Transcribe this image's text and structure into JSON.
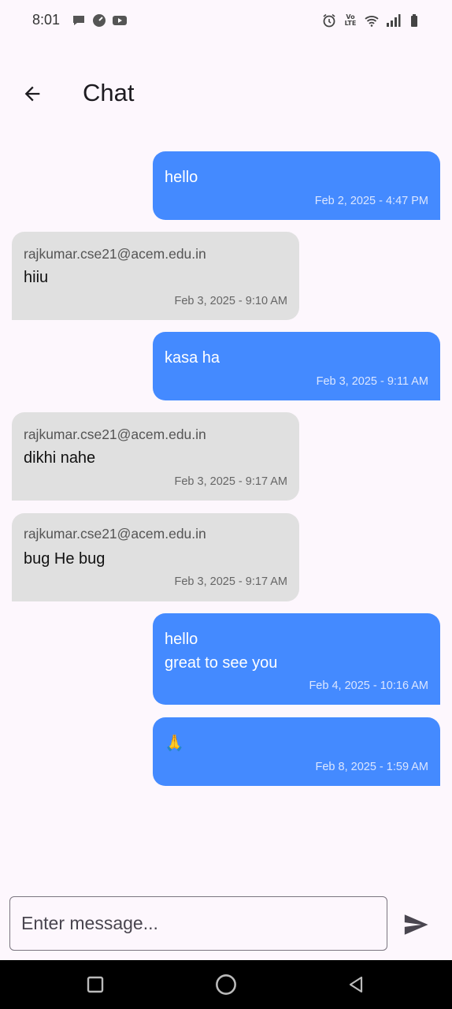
{
  "status_bar": {
    "time": "8:01",
    "left_icons": [
      "chat-notification-icon",
      "speedometer-icon",
      "youtube-icon"
    ],
    "right_icons": [
      "alarm-icon",
      "volte-icon",
      "wifi-icon",
      "signal-icon",
      "battery-icon"
    ],
    "volte_text": "Vo LTE"
  },
  "app_bar": {
    "title": "Chat",
    "back_icon": "arrow-left-icon"
  },
  "messages": [
    {
      "type": "sent",
      "text": "hello",
      "time": "Feb 2, 2025 - 4:47 PM"
    },
    {
      "type": "received",
      "sender": "rajkumar.cse21@acem.edu.in",
      "text": "hiiu",
      "time": "Feb 3, 2025 - 9:10 AM"
    },
    {
      "type": "sent",
      "text": "kasa ha",
      "time": "Feb 3, 2025 - 9:11 AM"
    },
    {
      "type": "received",
      "sender": "rajkumar.cse21@acem.edu.in",
      "text": "dikhi nahe",
      "time": "Feb 3, 2025 - 9:17 AM"
    },
    {
      "type": "received",
      "sender": "rajkumar.cse21@acem.edu.in",
      "text": "bug He bug",
      "time": "Feb 3, 2025 - 9:17 AM"
    },
    {
      "type": "sent",
      "text": "hello\ngreat to see you",
      "time": "Feb 4, 2025 - 10:16 AM"
    },
    {
      "type": "sent",
      "text": "🙏",
      "time": "Feb 8, 2025 - 1:59 AM"
    }
  ],
  "composer": {
    "placeholder": "Enter message...",
    "value": "",
    "send_icon": "send-icon"
  },
  "nav_bar": {
    "buttons": [
      "recents-square-icon",
      "home-circle-icon",
      "back-triangle-icon"
    ]
  },
  "colors": {
    "background": "#fdf7fd",
    "sent_bubble": "#448aff",
    "received_bubble": "#e0e0e0"
  }
}
